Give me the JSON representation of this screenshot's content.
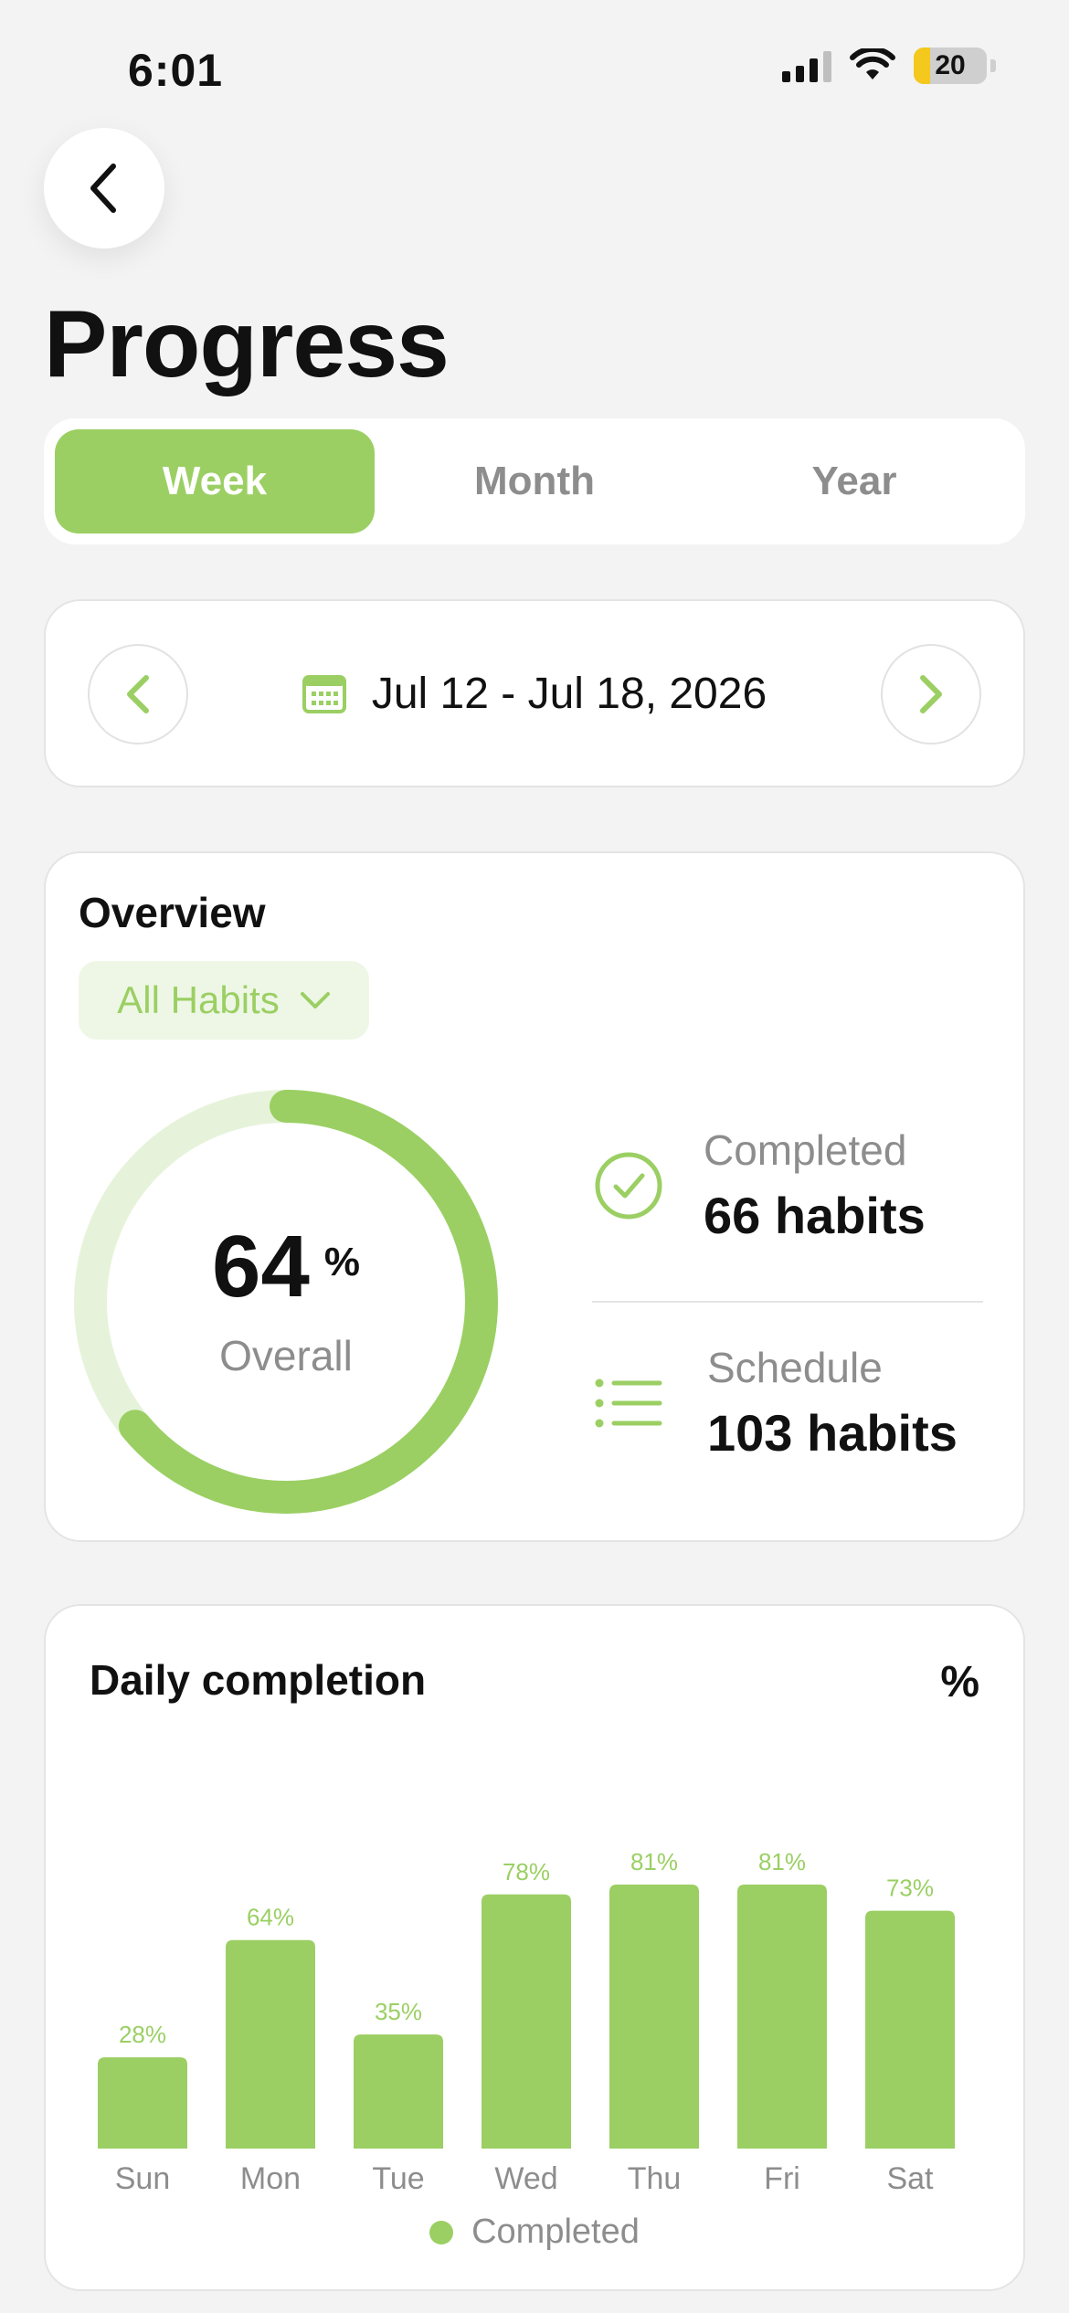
{
  "status_bar": {
    "time": "6:01",
    "battery": "20"
  },
  "header": {
    "title": "Progress"
  },
  "tabs": [
    {
      "label": "Week",
      "active": true
    },
    {
      "label": "Month",
      "active": false
    },
    {
      "label": "Year",
      "active": false
    }
  ],
  "week": {
    "range": "Jul 12 - Jul 18, 2026"
  },
  "overview": {
    "title": "Overview",
    "filter": "All Habits",
    "percent": "64",
    "percent_sign": "%",
    "overall_label": "Overall",
    "progress_fraction": 0.64,
    "completed": {
      "label": "Completed",
      "value": "66 habits"
    },
    "schedule": {
      "label": "Schedule",
      "value": "103 habits"
    }
  },
  "chart_data": {
    "type": "bar",
    "title": "Daily completion",
    "unit": "%",
    "categories": [
      "Sun",
      "Mon",
      "Tue",
      "Wed",
      "Thu",
      "Fri",
      "Sat"
    ],
    "values": [
      28,
      64,
      35,
      78,
      81,
      81,
      73
    ],
    "value_labels": [
      "28%",
      "64%",
      "35%",
      "78%",
      "81%",
      "81%",
      "73%"
    ],
    "series": [
      {
        "name": "Completed",
        "values": [
          28,
          64,
          35,
          78,
          81,
          81,
          73
        ]
      }
    ],
    "ylim": [
      0,
      100
    ],
    "grid": false,
    "legend": "bottom-center"
  },
  "colors": {
    "accent": "#9bcf63",
    "accent_light": "#e6f3da",
    "muted_text": "#8d8d8d"
  }
}
